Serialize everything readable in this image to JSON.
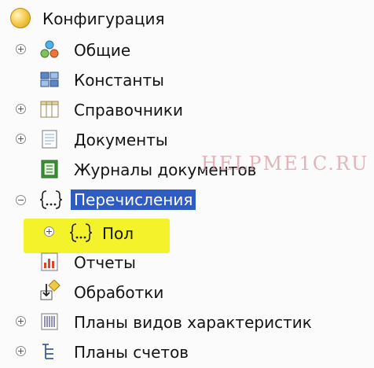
{
  "tree": {
    "root_label": "Конфигурация",
    "items": [
      {
        "label": "Общие",
        "icon": "common-objects-icon",
        "expander": "plus"
      },
      {
        "label": "Константы",
        "icon": "constants-icon",
        "expander": ""
      },
      {
        "label": "Справочники",
        "icon": "catalogs-icon",
        "expander": "plus"
      },
      {
        "label": "Документы",
        "icon": "documents-icon",
        "expander": "plus"
      },
      {
        "label": "Журналы документов",
        "icon": "document-journals-icon",
        "expander": ""
      },
      {
        "label": "Перечисления",
        "icon": "enumerations-icon",
        "expander": "minus",
        "selected": true
      },
      {
        "label": "Пол",
        "icon": "enumeration-icon",
        "expander": "plus",
        "child": true
      },
      {
        "label": "Отчеты",
        "icon": "reports-icon",
        "expander": ""
      },
      {
        "label": "Обработки",
        "icon": "data-processors-icon",
        "expander": ""
      },
      {
        "label": "Планы видов характеристик",
        "icon": "characteristic-types-icon",
        "expander": "plus"
      },
      {
        "label": "Планы счетов",
        "icon": "charts-of-accounts-icon",
        "expander": "plus"
      }
    ]
  },
  "watermark": "HELPME1C.RU",
  "colors": {
    "selection": "#2f5cc2",
    "highlight": "#f4f22a",
    "watermark": "#d68c96"
  }
}
